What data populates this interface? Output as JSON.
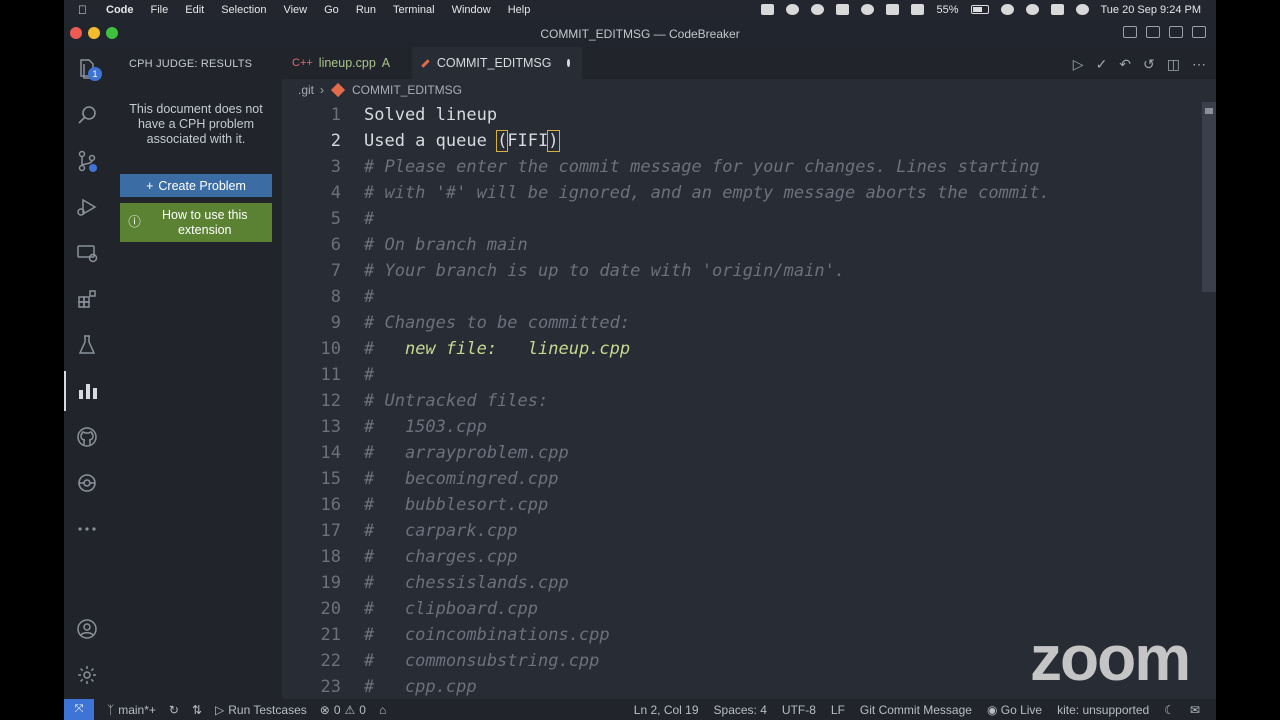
{
  "menubar": {
    "app": "Code",
    "items": [
      "File",
      "Edit",
      "Selection",
      "View",
      "Go",
      "Run",
      "Terminal",
      "Window",
      "Help"
    ],
    "battery": "55%",
    "datetime": "Tue 20 Sep  9:24 PM"
  },
  "window": {
    "title": "COMMIT_EDITMSG — CodeBreaker"
  },
  "activity": {
    "explorer_badge": "1"
  },
  "sidebar": {
    "heading": "CPH JUDGE: RESULTS",
    "message": "This document does not have a CPH problem associated with it.",
    "create_button": "Create Problem",
    "howto_button": "How to use this extension"
  },
  "tabs": [
    {
      "label": "lineup.cpp",
      "status": "A"
    },
    {
      "label": "COMMIT_EDITMSG"
    }
  ],
  "breadcrumb": {
    "folder": ".git",
    "file": "COMMIT_EDITMSG"
  },
  "editor": {
    "lines": [
      {
        "n": "1",
        "text": "Solved lineup",
        "kind": "plain"
      },
      {
        "n": "2",
        "text_before": "Used a queue ",
        "paren_open": "(",
        "text_mid": "FIFI",
        "paren_close": ")",
        "kind": "current"
      },
      {
        "n": "3",
        "text": "# Please enter the commit message for your changes. Lines starting",
        "kind": "comment"
      },
      {
        "n": "4",
        "text": "# with '#' will be ignored, and an empty message aborts the commit.",
        "kind": "comment"
      },
      {
        "n": "5",
        "text": "#",
        "kind": "comment"
      },
      {
        "n": "6",
        "text": "# On branch main",
        "kind": "comment"
      },
      {
        "n": "7",
        "text": "# Your branch is up to date with 'origin/main'.",
        "kind": "comment"
      },
      {
        "n": "8",
        "text": "#",
        "kind": "comment"
      },
      {
        "n": "9",
        "text": "# Changes to be committed:",
        "kind": "comment"
      },
      {
        "n": "10",
        "text_hash": "#   ",
        "text": "new file:   lineup.cpp",
        "kind": "newfile"
      },
      {
        "n": "11",
        "text": "#",
        "kind": "comment"
      },
      {
        "n": "12",
        "text": "# Untracked files:",
        "kind": "comment"
      },
      {
        "n": "13",
        "text": "#   1503.cpp",
        "kind": "comment"
      },
      {
        "n": "14",
        "text": "#   arrayproblem.cpp",
        "kind": "comment"
      },
      {
        "n": "15",
        "text": "#   becomingred.cpp",
        "kind": "comment"
      },
      {
        "n": "16",
        "text": "#   bubblesort.cpp",
        "kind": "comment"
      },
      {
        "n": "17",
        "text": "#   carpark.cpp",
        "kind": "comment"
      },
      {
        "n": "18",
        "text": "#   charges.cpp",
        "kind": "comment"
      },
      {
        "n": "19",
        "text": "#   chessislands.cpp",
        "kind": "comment"
      },
      {
        "n": "20",
        "text": "#   clipboard.cpp",
        "kind": "comment"
      },
      {
        "n": "21",
        "text": "#   coincombinations.cpp",
        "kind": "comment"
      },
      {
        "n": "22",
        "text": "#   commonsubstring.cpp",
        "kind": "comment"
      },
      {
        "n": "23",
        "text": "#   cpp.cpp",
        "kind": "comment"
      }
    ]
  },
  "statusbar": {
    "branch": "main*+",
    "run_testcases": "Run Testcases",
    "errors": "0",
    "warnings": "0",
    "position": "Ln 2, Col 19",
    "spaces": "Spaces: 4",
    "encoding": "UTF-8",
    "eol": "LF",
    "language": "Git Commit Message",
    "golive": "Go Live",
    "kite": "kite: unsupported"
  },
  "overlay": {
    "logo": "zoom"
  }
}
